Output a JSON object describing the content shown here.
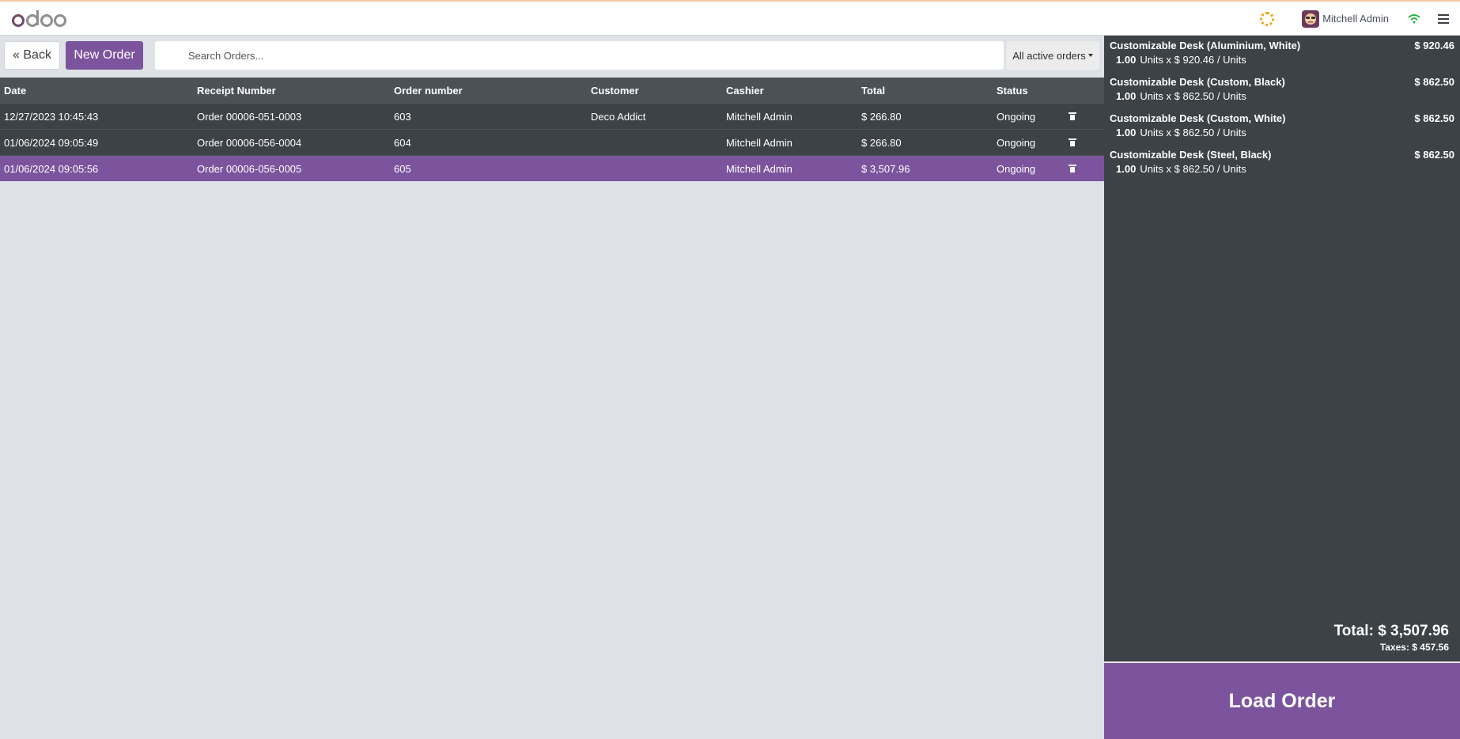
{
  "header": {
    "logo_text": "odoo",
    "user_name": "Mitchell Admin"
  },
  "controls": {
    "back_label": "« Back",
    "new_order_label": "New Order",
    "search_placeholder": "Search Orders...",
    "filter_label": "All active orders"
  },
  "table": {
    "columns": [
      "Date",
      "Receipt Number",
      "Order number",
      "Customer",
      "Cashier",
      "Total",
      "Status"
    ],
    "rows": [
      {
        "date": "12/27/2023 10:45:43",
        "receipt": "Order 00006-051-0003",
        "number": "603",
        "customer": "Deco Addict",
        "cashier": "Mitchell Admin",
        "total": "$ 266.80",
        "status": "Ongoing"
      },
      {
        "date": "01/06/2024 09:05:49",
        "receipt": "Order 00006-056-0004",
        "number": "604",
        "customer": "",
        "cashier": "Mitchell Admin",
        "total": "$ 266.80",
        "status": "Ongoing"
      },
      {
        "date": "01/06/2024 09:05:56",
        "receipt": "Order 00006-056-0005",
        "number": "605",
        "customer": "",
        "cashier": "Mitchell Admin",
        "total": "$ 3,507.96",
        "status": "Ongoing"
      }
    ]
  },
  "order_lines": [
    {
      "name": "Customizable Desk (Aluminium, White)",
      "price": "$ 920.46",
      "qty": "1.00",
      "detail": "Units x $ 920.46 / Units"
    },
    {
      "name": "Customizable Desk (Custom, Black)",
      "price": "$ 862.50",
      "qty": "1.00",
      "detail": "Units x $ 862.50 / Units"
    },
    {
      "name": "Customizable Desk (Custom, White)",
      "price": "$ 862.50",
      "qty": "1.00",
      "detail": "Units x $ 862.50 / Units"
    },
    {
      "name": "Customizable Desk (Steel, Black)",
      "price": "$ 862.50",
      "qty": "1.00",
      "detail": "Units x $ 862.50 / Units"
    }
  ],
  "summary": {
    "total": "Total: $ 3,507.96",
    "taxes": "Taxes: $ 457.56"
  },
  "load_order_label": "Load Order",
  "colors": {
    "accent": "#7c549e",
    "panel": "#3d4246",
    "table_header": "#4a5157",
    "background": "#dee2e6"
  }
}
